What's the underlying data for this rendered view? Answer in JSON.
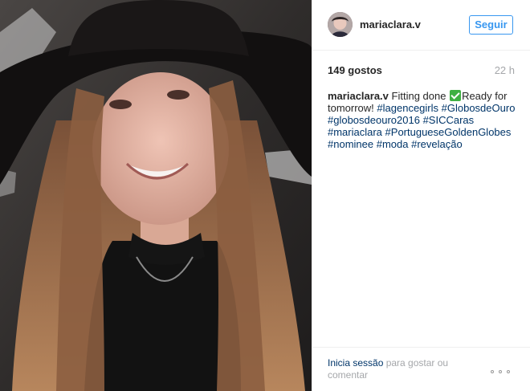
{
  "photo": {
    "alt": "Selfie of a young woman wearing a wide-brimmed black hat in a car"
  },
  "header": {
    "username": "mariaclara.v",
    "follow_label": "Seguir"
  },
  "stats": {
    "likes": "149 gostos",
    "time": "22 h"
  },
  "caption": {
    "username": "mariaclara.v",
    "text_1": " Fitting done ",
    "text_2": "Ready for tomorrow! ",
    "tags": [
      "#lagencegirls",
      "#GlobosdeOuro",
      "#globosdeouro2016",
      "#SICCaras",
      "#mariaclara",
      "#PortugueseGoldenGlobes",
      "#nominee",
      "#moda",
      "#revelação"
    ]
  },
  "footer": {
    "login_link": "Inicia sessão",
    "login_rest": " para gostar ou comentar"
  },
  "icons": {
    "check": "check-mark-emoji-icon",
    "more": "more-options-icon"
  }
}
